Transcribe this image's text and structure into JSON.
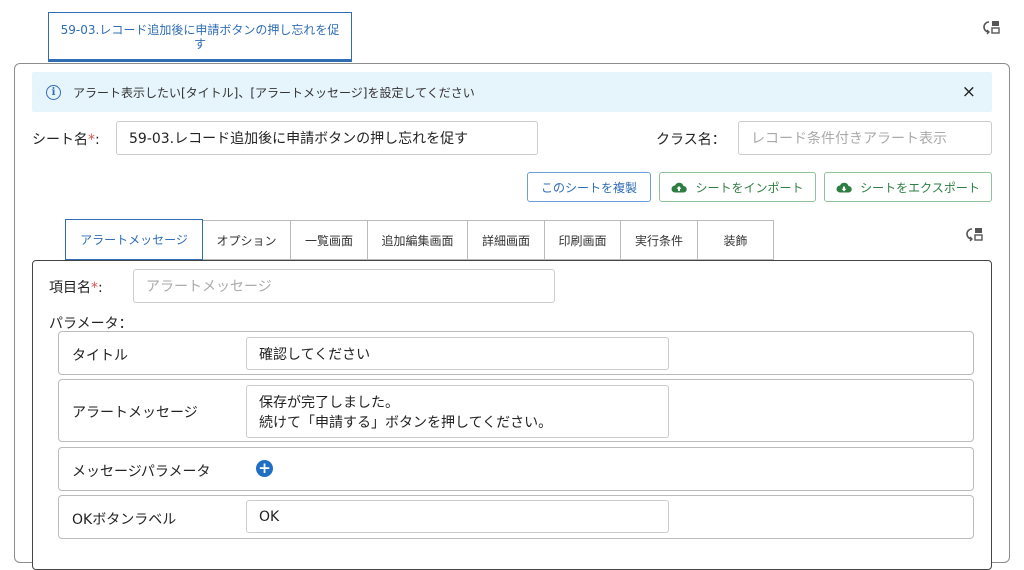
{
  "top_tab": {
    "label": "59-03.レコード追加後に申請ボタンの押し忘れを促す"
  },
  "alert": {
    "message": "アラート表示したい[タイトル]、[アラートメッセージ]を設定してください",
    "close": "×"
  },
  "sheet_name": {
    "label": "シート名",
    "required": "*",
    "colon": ":",
    "value": "59-03.レコード追加後に申請ボタンの押し忘れを促す"
  },
  "class_name": {
    "label": "クラス名：",
    "placeholder": "レコード条件付きアラート表示"
  },
  "buttons": {
    "copy_sheet": "このシートを複製",
    "import_sheet": "シートをインポート",
    "export_sheet": "シートをエクスポート"
  },
  "tabs": [
    "アラートメッセージ",
    "オプション",
    "一覧画面",
    "追加編集画面",
    "詳細画面",
    "印刷画面",
    "実行条件",
    "装飾"
  ],
  "item_name": {
    "label": "項目名",
    "required": "*",
    "colon": ":",
    "placeholder": "アラートメッセージ"
  },
  "params": {
    "label": "パラメータ：",
    "title": {
      "label": "タイトル",
      "value": "確認してください"
    },
    "alert_message": {
      "label": "アラートメッセージ",
      "line1": "保存が完了しました。",
      "line2": "続けて「申請する」ボタンを押してください。"
    },
    "message_params": {
      "label": "メッセージパラメータ"
    },
    "ok_label": {
      "label": "OKボタンラベル",
      "value": "OK"
    }
  },
  "colors": {
    "accent": "#2f6db5",
    "alert_bg": "#e6f4fb",
    "green": "#2e7d42",
    "required": "#d9534f"
  }
}
